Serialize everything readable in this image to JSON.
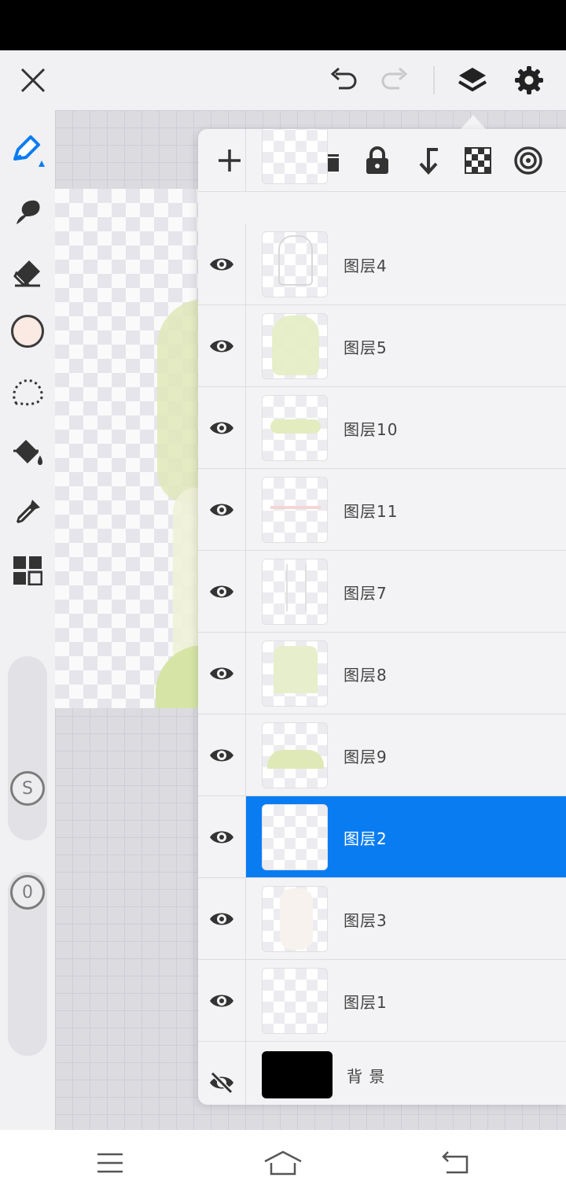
{
  "topbar": {
    "icons": [
      "close-icon",
      "undo-icon",
      "redo-icon",
      "layers-icon",
      "gear-icon"
    ]
  },
  "toolbar": {
    "tools": [
      "pen-icon",
      "smudge-icon",
      "eraser-icon",
      "color-swatch",
      "lasso-icon",
      "fill-bucket-icon",
      "eyedropper-icon",
      "grid-icon"
    ],
    "color": "#fbe9e4",
    "size_slider_label": "S",
    "opacity_slider_label": "0"
  },
  "layer_panel": {
    "tool_icons": [
      "add-icon",
      "folder-icon",
      "lock-icon",
      "merge-down-icon",
      "checkerboard-icon",
      "target-icon"
    ],
    "layers": [
      {
        "name": "图层4",
        "visible": true
      },
      {
        "name": "图层5",
        "visible": true
      },
      {
        "name": "图层10",
        "visible": true
      },
      {
        "name": "图层11",
        "visible": true
      },
      {
        "name": "图层7",
        "visible": true
      },
      {
        "name": "图层8",
        "visible": true
      },
      {
        "name": "图层9",
        "visible": true
      },
      {
        "name": "图层2",
        "visible": true,
        "selected": true
      },
      {
        "name": "图层3",
        "visible": true
      },
      {
        "name": "图层1",
        "visible": true
      },
      {
        "name": "背 景",
        "visible": false
      }
    ],
    "selected_color": "#0a7cf2"
  },
  "navbar": {
    "icons": [
      "menu-icon",
      "home-icon",
      "back-icon"
    ]
  }
}
